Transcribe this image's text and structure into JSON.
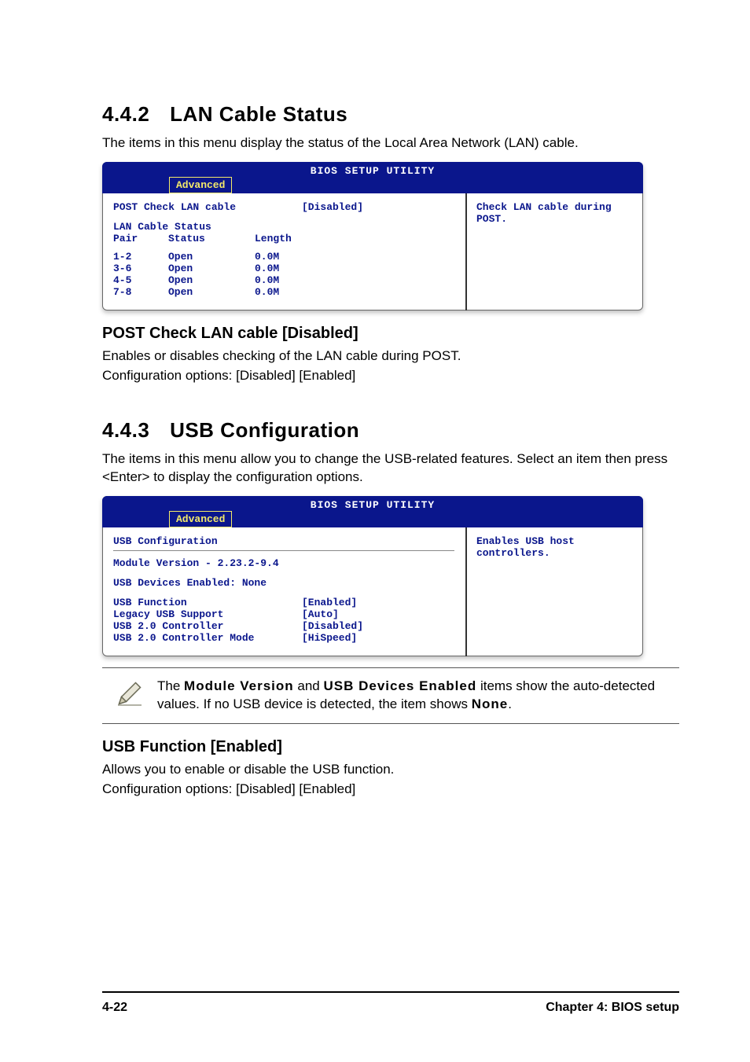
{
  "section1": {
    "number": "4.4.2",
    "title": "LAN Cable Status",
    "intro": "The items in this menu display the status of the Local Area Network (LAN) cable."
  },
  "bios1": {
    "title": "BIOS SETUP UTILITY",
    "tab": "Advanced",
    "help": "Check LAN cable during POST.",
    "opt_label": "POST Check LAN cable",
    "opt_value": "[Disabled]",
    "table_title": "LAN Cable Status",
    "hdr": {
      "c1": "Pair",
      "c2": "Status",
      "c3": "Length"
    },
    "rows": [
      {
        "c1": "1-2",
        "c2": "Open",
        "c3": "0.0M"
      },
      {
        "c1": "3-6",
        "c2": "Open",
        "c3": "0.0M"
      },
      {
        "c1": "4-5",
        "c2": "Open",
        "c3": "0.0M"
      },
      {
        "c1": "7-8",
        "c2": "Open",
        "c3": "0.0M"
      }
    ]
  },
  "sub1": {
    "heading": "POST Check LAN cable [Disabled]",
    "line1": "Enables or disables checking of the LAN cable during POST.",
    "line2": "Configuration options: [Disabled] [Enabled]"
  },
  "section2": {
    "number": "4.4.3",
    "title": "USB Configuration",
    "intro": "The items in this menu allow you to change the USB-related features. Select an item then press <Enter> to display the configuration options."
  },
  "bios2": {
    "title": "BIOS SETUP UTILITY",
    "tab": "Advanced",
    "help": "Enables USB host controllers.",
    "heading": "USB Configuration",
    "line1": "Module Version - 2.23.2-9.4",
    "line2": "USB Devices Enabled: None",
    "opts": [
      {
        "label": "USB Function",
        "value": "[Enabled]"
      },
      {
        "label": "Legacy USB Support",
        "value": "[Auto]"
      },
      {
        "label": "USB 2.0 Controller",
        "value": "[Disabled]"
      },
      {
        "label": "USB 2.0 Controller Mode",
        "value": "[HiSpeed]"
      }
    ]
  },
  "note": {
    "t1": "The ",
    "b1": "Module Version",
    "t2": " and ",
    "b2": "USB Devices Enabled",
    "t3": " items show the auto-detected values. If no USB device is detected, the item shows ",
    "b3": "None",
    "t4": "."
  },
  "sub2": {
    "heading": "USB Function [Enabled]",
    "line1": "Allows you to enable or disable the USB function.",
    "line2": "Configuration options: [Disabled] [Enabled]"
  },
  "footer": {
    "left": "4-22",
    "right": "Chapter 4: BIOS setup"
  }
}
